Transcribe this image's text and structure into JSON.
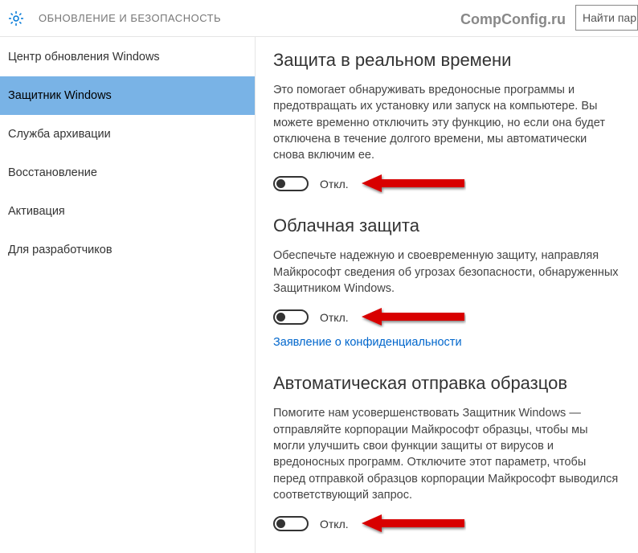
{
  "header": {
    "title": "ОБНОВЛЕНИЕ И БЕЗОПАСНОСТЬ",
    "watermark": "CompConfig.ru",
    "search_placeholder": "Найти пар"
  },
  "sidebar": {
    "items": [
      {
        "label": "Центр обновления Windows",
        "selected": false
      },
      {
        "label": "Защитник Windows",
        "selected": true
      },
      {
        "label": "Служба архивации",
        "selected": false
      },
      {
        "label": "Восстановление",
        "selected": false
      },
      {
        "label": "Активация",
        "selected": false
      },
      {
        "label": "Для разработчиков",
        "selected": false
      }
    ]
  },
  "sections": {
    "realtime": {
      "title": "Защита в реальном времени",
      "desc": "Это помогает обнаруживать вредоносные программы и предотвращать их установку или запуск на компьютере. Вы можете временно отключить эту функцию, но если она будет отключена в течение долгого времени, мы автоматически снова включим ее.",
      "toggle_label": "Откл."
    },
    "cloud": {
      "title": "Облачная защита",
      "desc": "Обеспечьте надежную и своевременную защиту, направляя Майкрософт сведения об угрозах безопасности, обнаруженных Защитником Windows.",
      "toggle_label": "Откл.",
      "privacy_link": "Заявление о конфиденциальности"
    },
    "samples": {
      "title": "Автоматическая отправка образцов",
      "desc": "Помогите нам усовершенствовать Защитник Windows — отправляйте корпорации Майкрософт образцы, чтобы мы могли улучшить свои функции защиты от вирусов и вредоносных программ. Отключите этот параметр, чтобы перед отправкой образцов корпорации Майкрософт выводился соответствующий запрос.",
      "toggle_label": "Откл."
    }
  }
}
